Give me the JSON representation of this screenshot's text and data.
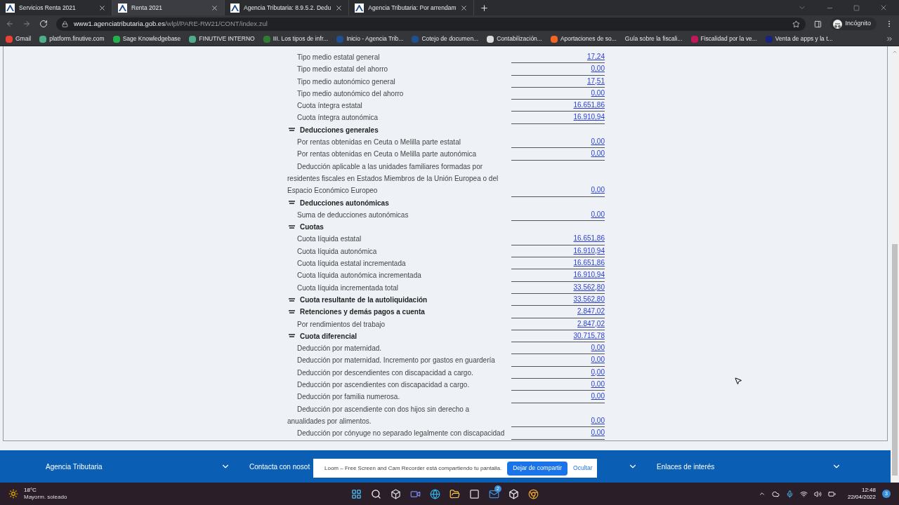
{
  "tabs": [
    {
      "title": "Servicios Renta 2021",
      "selected": false
    },
    {
      "title": "Renta 2021",
      "selected": true
    },
    {
      "title": "Agencia Tributaria: 8.9.5.2. Dedu",
      "selected": false
    },
    {
      "title": "Agencia Tributaria: Por arrendam",
      "selected": false
    }
  ],
  "address": {
    "host": "www1.agenciatributaria.gob.es",
    "path": "/wlpl/PARE-RW21/CONT/index.zul"
  },
  "profile": {
    "label": "Incógnito"
  },
  "bookmarks": [
    {
      "label": "Gmail",
      "color": "#ea4335"
    },
    {
      "label": "platform.finutive.com",
      "color": "#4fae8a"
    },
    {
      "label": "Sage Knowledgebase",
      "color": "#22b14c"
    },
    {
      "label": "FINUTIVE INTERNO",
      "color": "#4fae8a"
    },
    {
      "label": "III. Los tipos de infr...",
      "color": "#2e7d32"
    },
    {
      "label": "Inicio - Agencia Trib...",
      "color": "#1d4f91"
    },
    {
      "label": "Cotejo de documen...",
      "color": "#1d4f91"
    },
    {
      "label": "Contabilización...",
      "color": "#dddddd"
    },
    {
      "label": "Aportaciones de so...",
      "color": "#f26522"
    },
    {
      "label": "Guía sobre la fiscali..."
    },
    {
      "label": "Fiscalidad por la ve...",
      "color": "#c2185b"
    },
    {
      "label": "Venta de apps y la t...",
      "color": "#1a237e"
    }
  ],
  "rows": [
    {
      "kind": "item",
      "label": "Tipo medio estatal general",
      "value": "17,24"
    },
    {
      "kind": "item",
      "label": "Tipo medio estatal del ahorro",
      "value": "0,00"
    },
    {
      "kind": "item",
      "label": "Tipo medio autonómico general",
      "value": "17,51"
    },
    {
      "kind": "item",
      "label": "Tipo medio autonómico del ahorro",
      "value": "0,00"
    },
    {
      "kind": "item",
      "label": "Cuota íntegra estatal",
      "value": "16.651,86"
    },
    {
      "kind": "item",
      "label": "Cuota íntegra autonómica",
      "value": "16.910,94"
    },
    {
      "kind": "section",
      "label": "Deducciones generales"
    },
    {
      "kind": "item",
      "label": "Por rentas obtenidas en Ceuta o Melilla parte estatal",
      "value": "0,00"
    },
    {
      "kind": "item",
      "label": "Por rentas obtenidas en Ceuta o Melilla parte autonómica",
      "value": "0,00"
    },
    {
      "kind": "item",
      "label": "Deducción aplicable a las unidades familiares formadas por residentes fiscales en Estados Miembros de la Unión Europea o del Espacio Económico Europeo",
      "value": "0,00"
    },
    {
      "kind": "section",
      "label": "Deducciones autonómicas"
    },
    {
      "kind": "item",
      "label": "Suma de deducciones autonómicas",
      "value": "0,00"
    },
    {
      "kind": "section",
      "label": "Cuotas"
    },
    {
      "kind": "item",
      "label": "Cuota líquida estatal",
      "value": "16.651,86"
    },
    {
      "kind": "item",
      "label": "Cuota líquida autonómica",
      "value": "16.910,94"
    },
    {
      "kind": "item",
      "label": "Cuota líquida estatal incrementada",
      "value": "16.651,86"
    },
    {
      "kind": "item",
      "label": "Cuota líquida autonómica incrementada",
      "value": "16.910,94"
    },
    {
      "kind": "item",
      "label": "Cuota líquida incrementada total",
      "value": "33.562,80"
    },
    {
      "kind": "section",
      "label": "Cuota resultante de la autoliquidación",
      "value": "33.562,80"
    },
    {
      "kind": "section",
      "label": "Retenciones y demás pagos a cuenta",
      "value": "2.847,02"
    },
    {
      "kind": "item",
      "label": "Por rendimientos del trabajo",
      "value": "2.847,02"
    },
    {
      "kind": "section",
      "label": "Cuota diferencial",
      "value": "30.715,78"
    },
    {
      "kind": "item",
      "label": "Deducción por maternidad.",
      "value": "0,00"
    },
    {
      "kind": "item",
      "label": "Deducción por maternidad. Incremento por gastos en guardería",
      "value": "0,00"
    },
    {
      "kind": "item",
      "label": "Deducción por descendientes con discapacidad a cargo.",
      "value": "0,00"
    },
    {
      "kind": "item",
      "label": "Deducción por ascendientes con discapacidad a cargo.",
      "value": "0,00"
    },
    {
      "kind": "item",
      "label": "Deducción por familia numerosa.",
      "value": "0,00"
    },
    {
      "kind": "item",
      "label": "Deducción por ascendiente con dos hijos sin derecho a anualidades por alimentos.",
      "value": "0,00"
    },
    {
      "kind": "item",
      "label": "Deducción por cónyuge no separado legalmente con discapacidad",
      "value": "0,00"
    }
  ],
  "footer": [
    "Agencia Tributaria",
    "Contacta con nosot",
    "Enlaces de interés"
  ],
  "share_bar": {
    "message": "Loom – Free Screen and Cam Recorder está compartiendo tu pantalla.",
    "stop": "Dejar de compartir",
    "hide": "Ocultar"
  },
  "taskbar": {
    "temperature": "18°C",
    "weather": "Mayorm. soleado",
    "mail_badge": "2",
    "time": "12:48",
    "date": "22/04/2022",
    "notifications": "3"
  }
}
